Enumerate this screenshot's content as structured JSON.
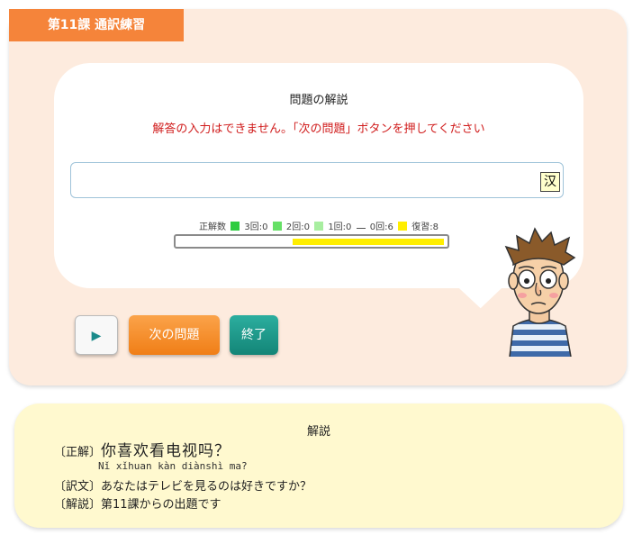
{
  "header": {
    "lesson_title": "第11課 通訳練習"
  },
  "bubble": {
    "title": "問題の解説",
    "warning": "解答の入力はできません。「次の問題」ボタンを押してください",
    "answer_value": "",
    "kanji_button": "汉"
  },
  "stats": {
    "correct_label": "正解数",
    "three": "3回:0",
    "two": "2回:0",
    "one": "1回:0",
    "zero": "0回:6",
    "review": "復習:8",
    "colors": {
      "three": "#2ecc40",
      "two": "#66e066",
      "one": "#a8eea0",
      "review": "#ffee00"
    },
    "progress_review_fraction": 0.57
  },
  "buttons": {
    "play": "▶",
    "next": "次の問題",
    "end": "終了"
  },
  "explanation": {
    "title": "解説",
    "answer_label": "〔正解〕",
    "answer_text": "你喜欢看电视吗？",
    "pinyin": "Nǐ xǐhuan kàn diànshì ma?",
    "translation_label": "〔訳文〕",
    "translation_text": "あなたはテレビを見るのは好きですか？",
    "note_label": "〔解説〕",
    "note_text": "第11課からの出題です"
  },
  "icons": {
    "character": "man-character-icon",
    "play": "play-icon"
  }
}
